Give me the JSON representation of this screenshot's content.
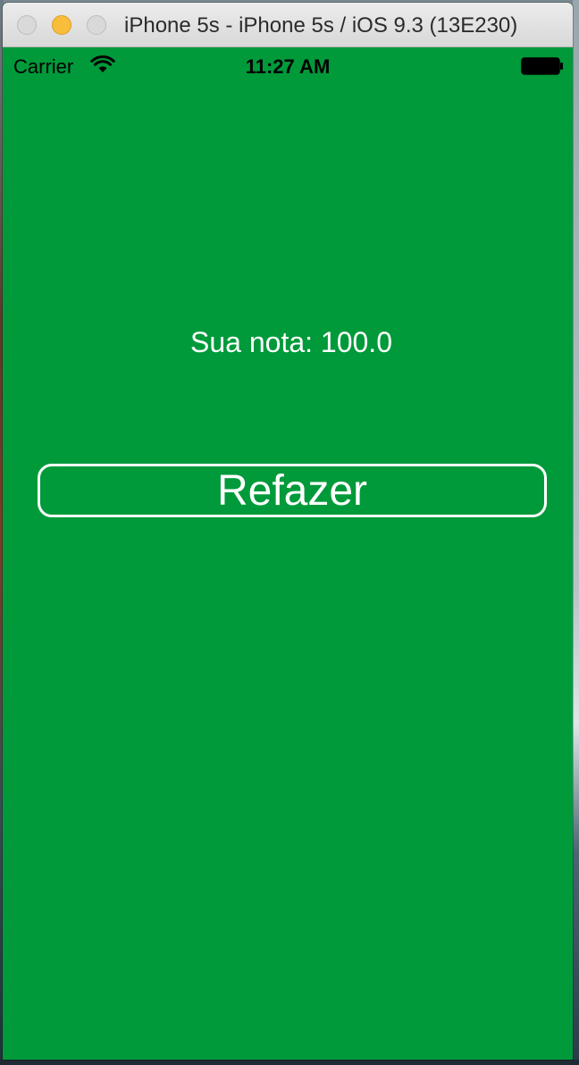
{
  "window": {
    "title": "iPhone 5s - iPhone 5s / iOS 9.3 (13E230)"
  },
  "statusbar": {
    "carrier": "Carrier",
    "time": "11:27 AM",
    "icons": [
      "wifi-icon",
      "battery-icon"
    ]
  },
  "screen": {
    "background_color": "#009a3a",
    "score_text": "Sua nota: 100.0",
    "redo_button_label": "Refazer"
  }
}
